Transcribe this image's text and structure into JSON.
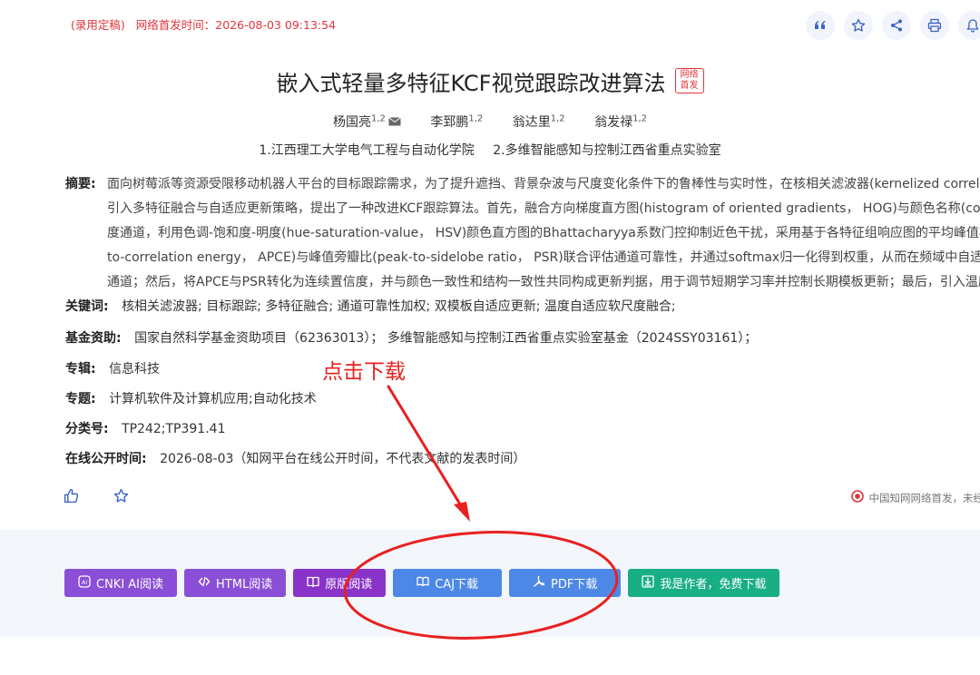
{
  "header": {
    "status_tag": "(录用定稿)",
    "first_pub_label": "网络首发时间：",
    "first_pub_time": "2026-08-03 09:13:54",
    "icons": [
      "quote-icon",
      "star-icon",
      "share-icon",
      "print-icon",
      "bell-icon"
    ]
  },
  "article": {
    "title": "嵌入式轻量多特征KCF视觉跟踪改进算法",
    "badge": "网络首发",
    "authors": [
      {
        "name": "杨国亮",
        "sup": "1,2"
      },
      {
        "name": "李郅鹏",
        "sup": "1,2"
      },
      {
        "name": "翁达里",
        "sup": "1,2"
      },
      {
        "name": "翁发禄",
        "sup": "1,2"
      }
    ],
    "affiliations": [
      "1.江西理工大学电气工程与自动化学院",
      "2.多维智能感知与控制江西省重点实验室"
    ]
  },
  "abstract": {
    "label": "摘要:",
    "lines": [
      "面向树莓派等资源受限移动机器人平台的目标跟踪需求，为了提升遮挡、背景杂波与尺度变化条件下的鲁棒性与实时性，在核相关滤波器(kernelized correlation",
      "引入多特征融合与自适应更新策略，提出了一种改进KCF跟踪算法。首先，融合方向梯度直方图(histogram of oriented gradients， HOG)与颜色名称(color n",
      "度通道，利用色调-饱和度-明度(hue-saturation-value， HSV)颜色直方图的Bhattacharyya系数门控抑制近色干扰，采用基于各特征组响应图的平均峰值相关",
      "to-correlation energy， APCE)与峰值旁瓣比(peak-to-sidelobe ratio， PSR)联合评估通道可靠性，并通过softmax归一化得到权重，从而在频域中自适应关联",
      "通道；然后，将APCE与PSR转化为连续置信度，并与颜色一致性和结构一致性共同构成更新判据，用于调节短期学习率并控制长期模板更新；最后，引入温度自"
    ]
  },
  "meta": {
    "keywords_label": "关键词:",
    "keywords": "核相关滤波器;  目标跟踪;  多特征融合;  通道可靠性加权;  双模板自适应更新;  温度自适应软尺度融合;",
    "fund_label": "基金资助:",
    "fund": "国家自然科学基金资助项目（62363013）；  多维智能感知与控制江西省重点实验室基金（2024SSY03161）；",
    "album_label": "专辑:",
    "album": "信息科技",
    "topic_label": "专题:",
    "topic": "计算机软件及计算机应用;自动化技术",
    "class_label": "分类号:",
    "class": "TP242;TP391.41",
    "online_label": "在线公开时间:",
    "online": "2026-08-03（知网平台在线公开时间，不代表文献的发表时间）"
  },
  "footer_note": "中国知网网络首发，未经",
  "buttons": {
    "ai": "CNKI AI阅读",
    "html": "HTML阅读",
    "orig": "原版阅读",
    "caj": "CAJ下载",
    "pdf": "PDF下载",
    "author": "我是作者，免费下载"
  },
  "annotation": {
    "text": "点击下载",
    "color": "#e8201f"
  }
}
